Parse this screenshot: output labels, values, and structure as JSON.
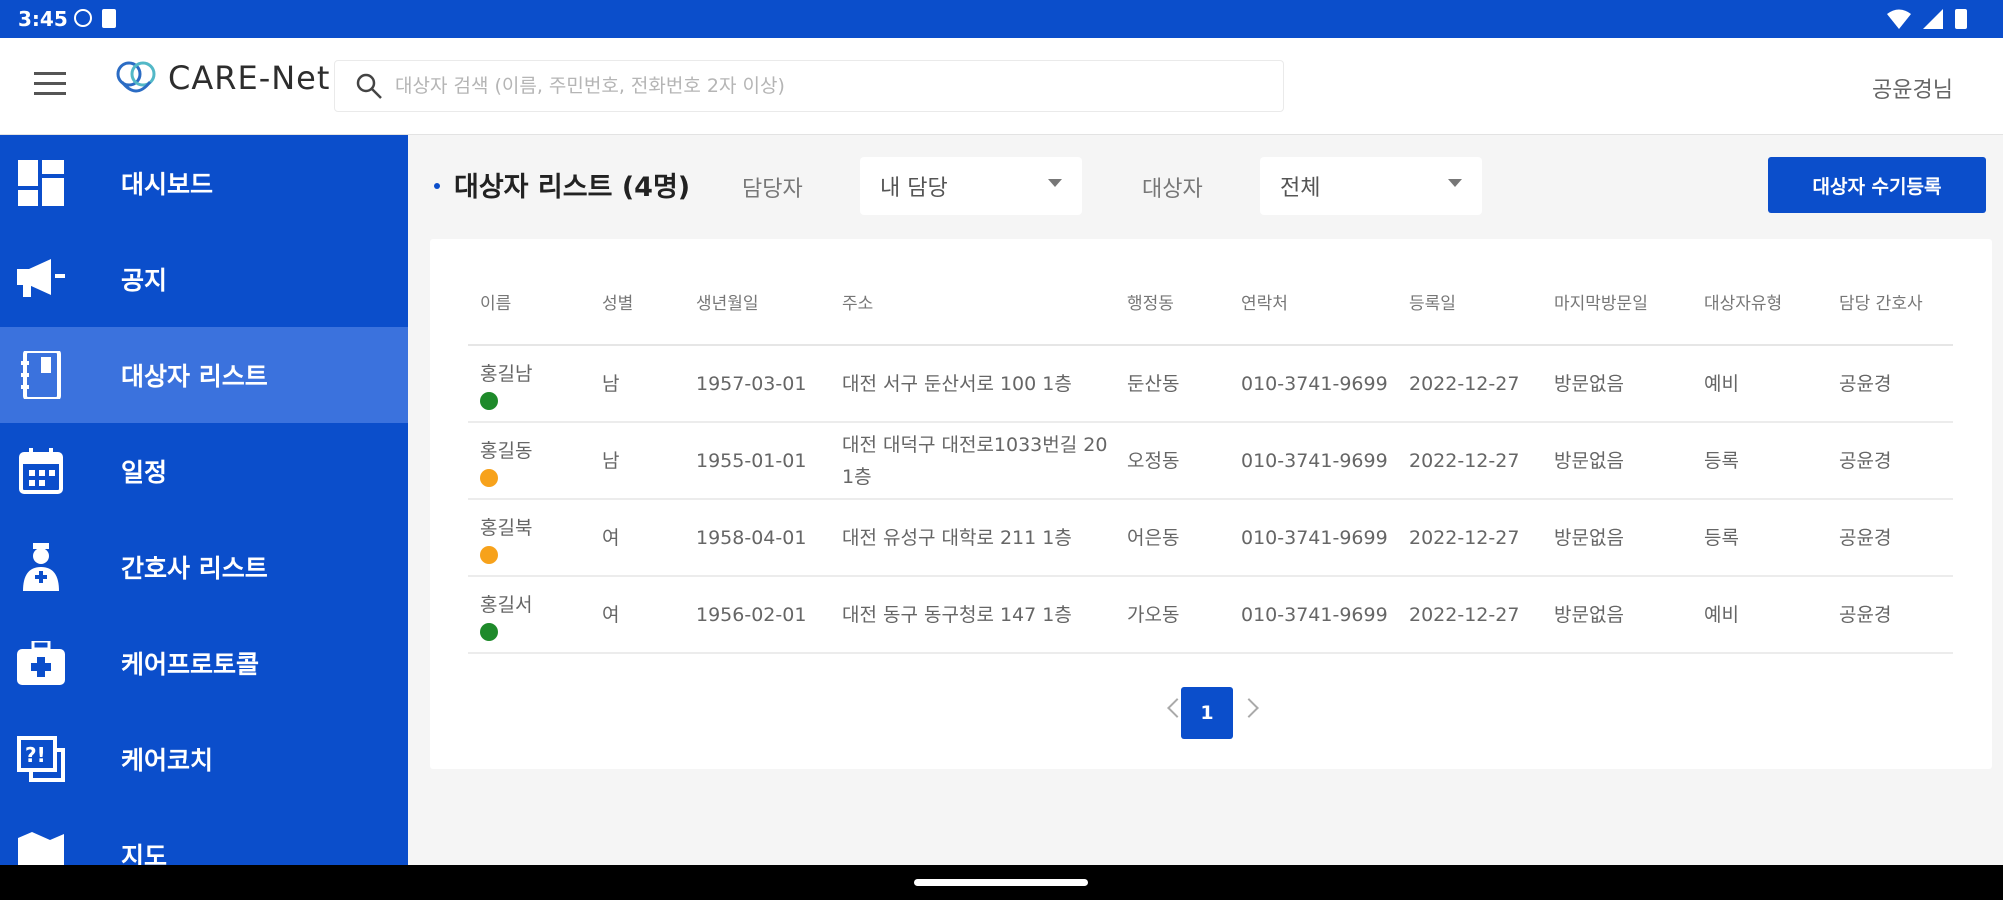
{
  "status_bar": {
    "time": "3:45"
  },
  "header": {
    "logo_text": "CARE-Net",
    "search_placeholder": "대상자 검색 (이름, 주민번호, 전화번호 2자 이상)",
    "user_name": "공윤경님"
  },
  "sidebar": {
    "items": [
      {
        "label": "대시보드",
        "icon": "dashboard-icon",
        "active": false
      },
      {
        "label": "공지",
        "icon": "megaphone-icon",
        "active": false
      },
      {
        "label": "대상자 리스트",
        "icon": "notebook-icon",
        "active": true
      },
      {
        "label": "일정",
        "icon": "calendar-icon",
        "active": false
      },
      {
        "label": "간호사 리스트",
        "icon": "nurse-icon",
        "active": false
      },
      {
        "label": "케어프로토콜",
        "icon": "medical-bag-icon",
        "active": false
      },
      {
        "label": "케어코치",
        "icon": "quiz-icon",
        "active": false
      },
      {
        "label": "지도",
        "icon": "map-icon",
        "active": false
      }
    ]
  },
  "toolbar": {
    "title": "대상자 리스트 (4명)",
    "manager_label": "담당자",
    "manager_value": "내 담당",
    "target_label": "대상자",
    "target_value": "전체",
    "register_button": "대상자 수기등록"
  },
  "table": {
    "headers": [
      "이름",
      "성별",
      "생년월일",
      "주소",
      "행정동",
      "연락처",
      "등록일",
      "마지막방문일",
      "대상자유형",
      "담당 간호사"
    ],
    "rows": [
      {
        "name": "홍길남",
        "status_color": "#1e8a2a",
        "gender": "남",
        "birth": "1957-03-01",
        "address": "대전 서구 둔산서로 100 1층",
        "dong": "둔산동",
        "phone": "010-3741-9699",
        "registered": "2022-12-27",
        "last_visit": "방문없음",
        "type": "예비",
        "nurse": "공윤경"
      },
      {
        "name": "홍길동",
        "status_color": "#f7a21b",
        "gender": "남",
        "birth": "1955-01-01",
        "address": "대전 대덕구 대전로1033번길 20 1층",
        "dong": "오정동",
        "phone": "010-3741-9699",
        "registered": "2022-12-27",
        "last_visit": "방문없음",
        "type": "등록",
        "nurse": "공윤경"
      },
      {
        "name": "홍길북",
        "status_color": "#f7a21b",
        "gender": "여",
        "birth": "1958-04-01",
        "address": "대전 유성구 대학로 211 1층",
        "dong": "어은동",
        "phone": "010-3741-9699",
        "registered": "2022-12-27",
        "last_visit": "방문없음",
        "type": "등록",
        "nurse": "공윤경"
      },
      {
        "name": "홍길서",
        "status_color": "#1e8a2a",
        "gender": "여",
        "birth": "1956-02-01",
        "address": "대전 동구 동구청로 147 1층",
        "dong": "가오동",
        "phone": "010-3741-9699",
        "registered": "2022-12-27",
        "last_visit": "방문없음",
        "type": "예비",
        "nurse": "공윤경"
      }
    ]
  },
  "pagination": {
    "current_page": "1"
  },
  "colors": {
    "primary": "#0b4ecb",
    "active_nav": "#3b72dd",
    "background": "#f5f5f5"
  }
}
